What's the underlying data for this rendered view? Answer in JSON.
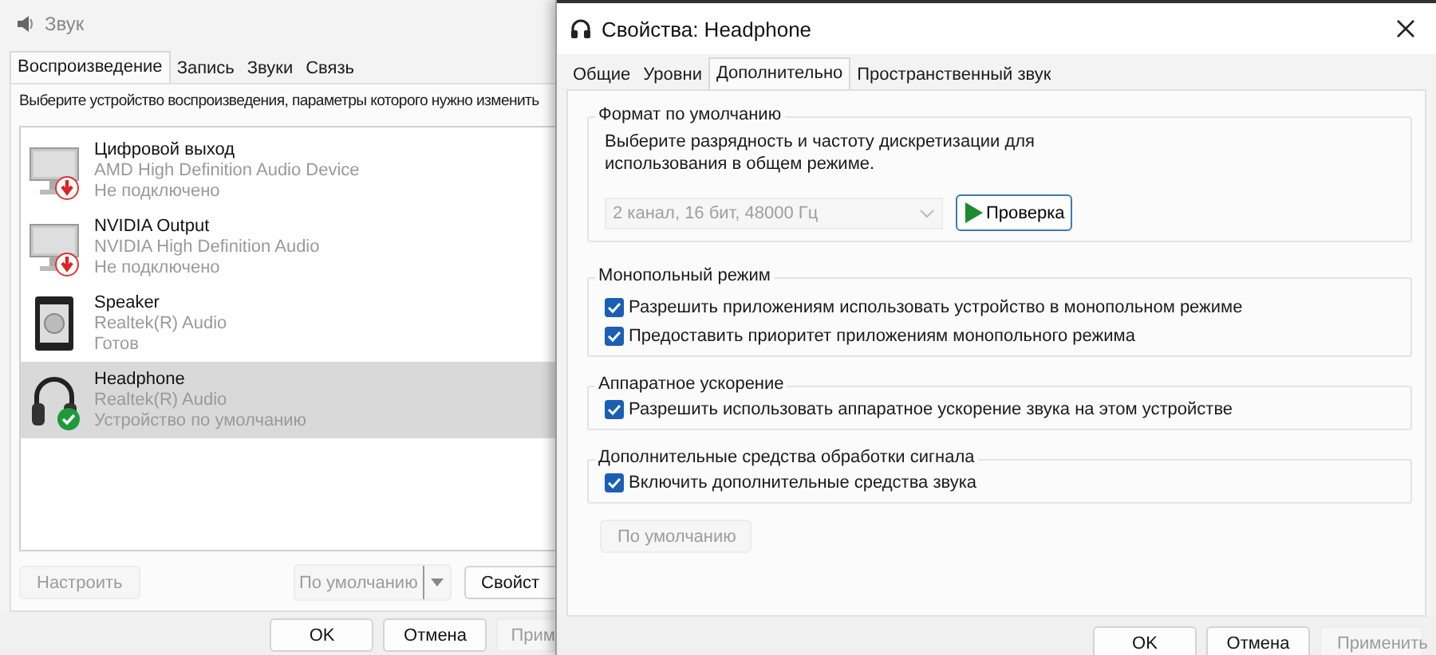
{
  "sound_window": {
    "title": "Звук",
    "tabs": [
      {
        "label": "Воспроизведение",
        "selected": true
      },
      {
        "label": "Запись",
        "selected": false
      },
      {
        "label": "Звуки",
        "selected": false
      },
      {
        "label": "Связь",
        "selected": false
      }
    ],
    "instruction": "Выберите устройство воспроизведения, параметры которого нужно изменить",
    "devices": [
      {
        "name": "Цифровой выход",
        "driver": "AMD High Definition Audio Device",
        "status": "Не подключено",
        "kind": "monitor",
        "connected": false,
        "default": false,
        "selected": false
      },
      {
        "name": "NVIDIA Output",
        "driver": "NVIDIA High Definition Audio",
        "status": "Не подключено",
        "kind": "monitor",
        "connected": false,
        "default": false,
        "selected": false
      },
      {
        "name": "Speaker",
        "driver": "Realtek(R) Audio",
        "status": "Готов",
        "kind": "speaker",
        "connected": true,
        "default": false,
        "selected": false
      },
      {
        "name": "Headphone",
        "driver": "Realtek(R) Audio",
        "status": "Устройство по умолчанию",
        "kind": "headphone",
        "connected": true,
        "default": true,
        "selected": true
      }
    ],
    "configure_button": {
      "label": "Настроить",
      "disabled": true
    },
    "default_button": {
      "label": "По умолчанию",
      "disabled": true
    },
    "properties_button": {
      "label": "Свойст"
    },
    "dialog_buttons": [
      {
        "label": "OK",
        "disabled": false
      },
      {
        "label": "Отмена",
        "disabled": false
      },
      {
        "label": "Прим",
        "disabled": true
      }
    ]
  },
  "properties_window": {
    "title": "Свойства: Headphone",
    "tabs": [
      {
        "label": "Общие",
        "selected": false
      },
      {
        "label": "Уровни",
        "selected": false
      },
      {
        "label": "Дополнительно",
        "selected": true
      },
      {
        "label": "Пространственный звук",
        "selected": false
      }
    ],
    "format_group": {
      "title": "Формат по умолчанию",
      "description": "Выберите разрядность и частоту дискретизации для использования в общем режиме.",
      "format_value": "2 канал, 16 бит, 48000 Гц",
      "format_disabled": true,
      "test_button": "Проверка"
    },
    "groups": [
      {
        "title": "Монопольный режим",
        "options": [
          {
            "label": "Разрешить приложениям использовать устройство в монопольном режиме",
            "checked": true
          },
          {
            "label": "Предоставить приоритет приложениям монопольного режима",
            "checked": true
          }
        ]
      },
      {
        "title": "Аппаратное ускорение",
        "options": [
          {
            "label": "Разрешить использовать аппаратное ускорение звука на этом устройстве",
            "checked": true
          }
        ]
      },
      {
        "title": "Дополнительные средства обработки сигнала",
        "options": [
          {
            "label": "Включить дополнительные средства звука",
            "checked": true
          }
        ]
      }
    ],
    "restore_button": {
      "label": "По умолчанию",
      "disabled": true
    },
    "dialog_buttons": [
      {
        "label": "OK",
        "disabled": false
      },
      {
        "label": "Отмена",
        "disabled": false
      },
      {
        "label": "Применить",
        "disabled": true
      }
    ]
  }
}
